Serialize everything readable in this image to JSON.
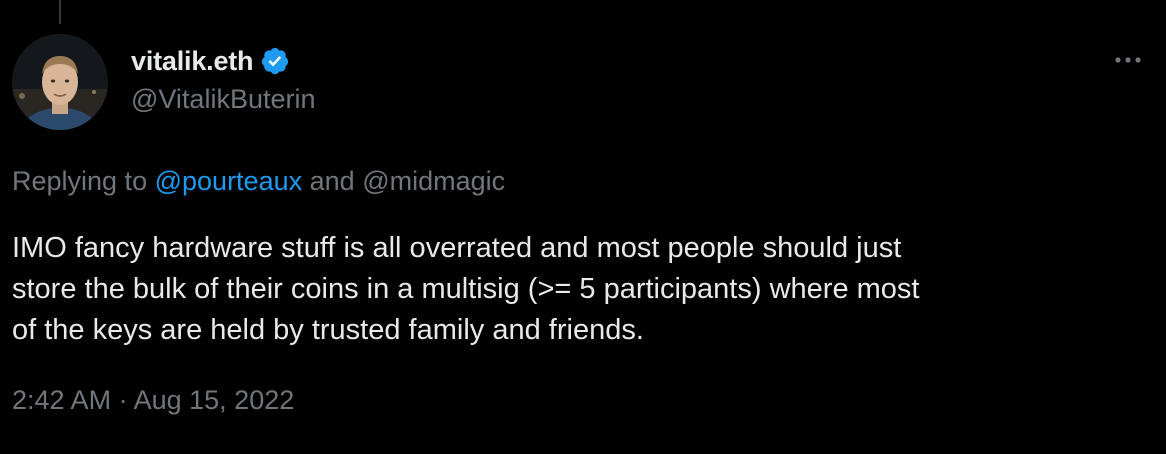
{
  "tweet": {
    "author": {
      "display_name": "vitalik.eth",
      "handle": "@VitalikButerin",
      "verified": true,
      "verified_icon": "verified-badge-icon",
      "verified_color": "#1d9bf0"
    },
    "more_icon": "more-horizontal-icon",
    "reply": {
      "prefix": "Replying to",
      "mention_1": "@pourteaux",
      "joiner": "and",
      "mention_2": "@midmagic"
    },
    "text_lines": [
      "IMO fancy hardware stuff is all overrated and most people should just",
      "store the bulk of their coins in a multisig (>= 5 participants) where most",
      "of the keys are held by trusted family and friends."
    ],
    "time": "2:42 AM",
    "separator": "·",
    "date": "Aug 15, 2022"
  },
  "colors": {
    "background": "#000000",
    "primary_text": "#e7e9ea",
    "secondary_text": "#71767b",
    "accent": "#1d9bf0"
  }
}
